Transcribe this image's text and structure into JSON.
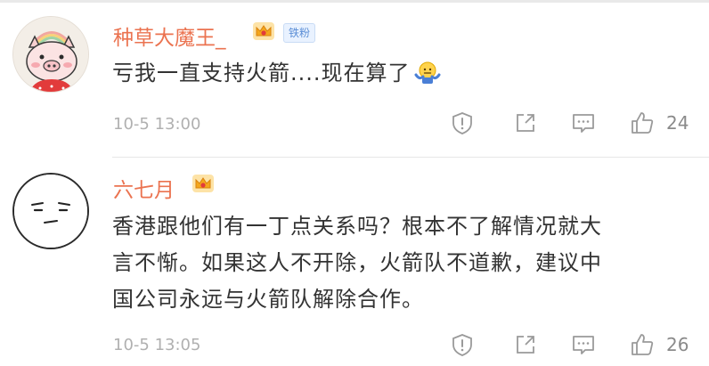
{
  "comments": [
    {
      "username": "种草大魔王_",
      "badge": "铁粉",
      "text_lines": [
        "亏我一直支持火箭....现在算了"
      ],
      "emoji": "shrug-emoji",
      "time": "10-5 13:00",
      "likes": "24"
    },
    {
      "username": "六七月",
      "text_lines": [
        "香港跟他们有一丁点关系吗？根本不了解情况就大",
        "言不惭。如果这人不开除，火箭队不道歉，建议中",
        "国公司永远与火箭队解除合作。"
      ],
      "time": "10-5 13:05",
      "likes": "26"
    }
  ],
  "colors": {
    "username": "#eb7350",
    "text": "#333333",
    "meta": "#b0b0b0",
    "icon": "#9a9a9a"
  },
  "icons": [
    "report-icon",
    "forward-icon",
    "comment-icon",
    "like-icon",
    "vip-crown-icon"
  ]
}
